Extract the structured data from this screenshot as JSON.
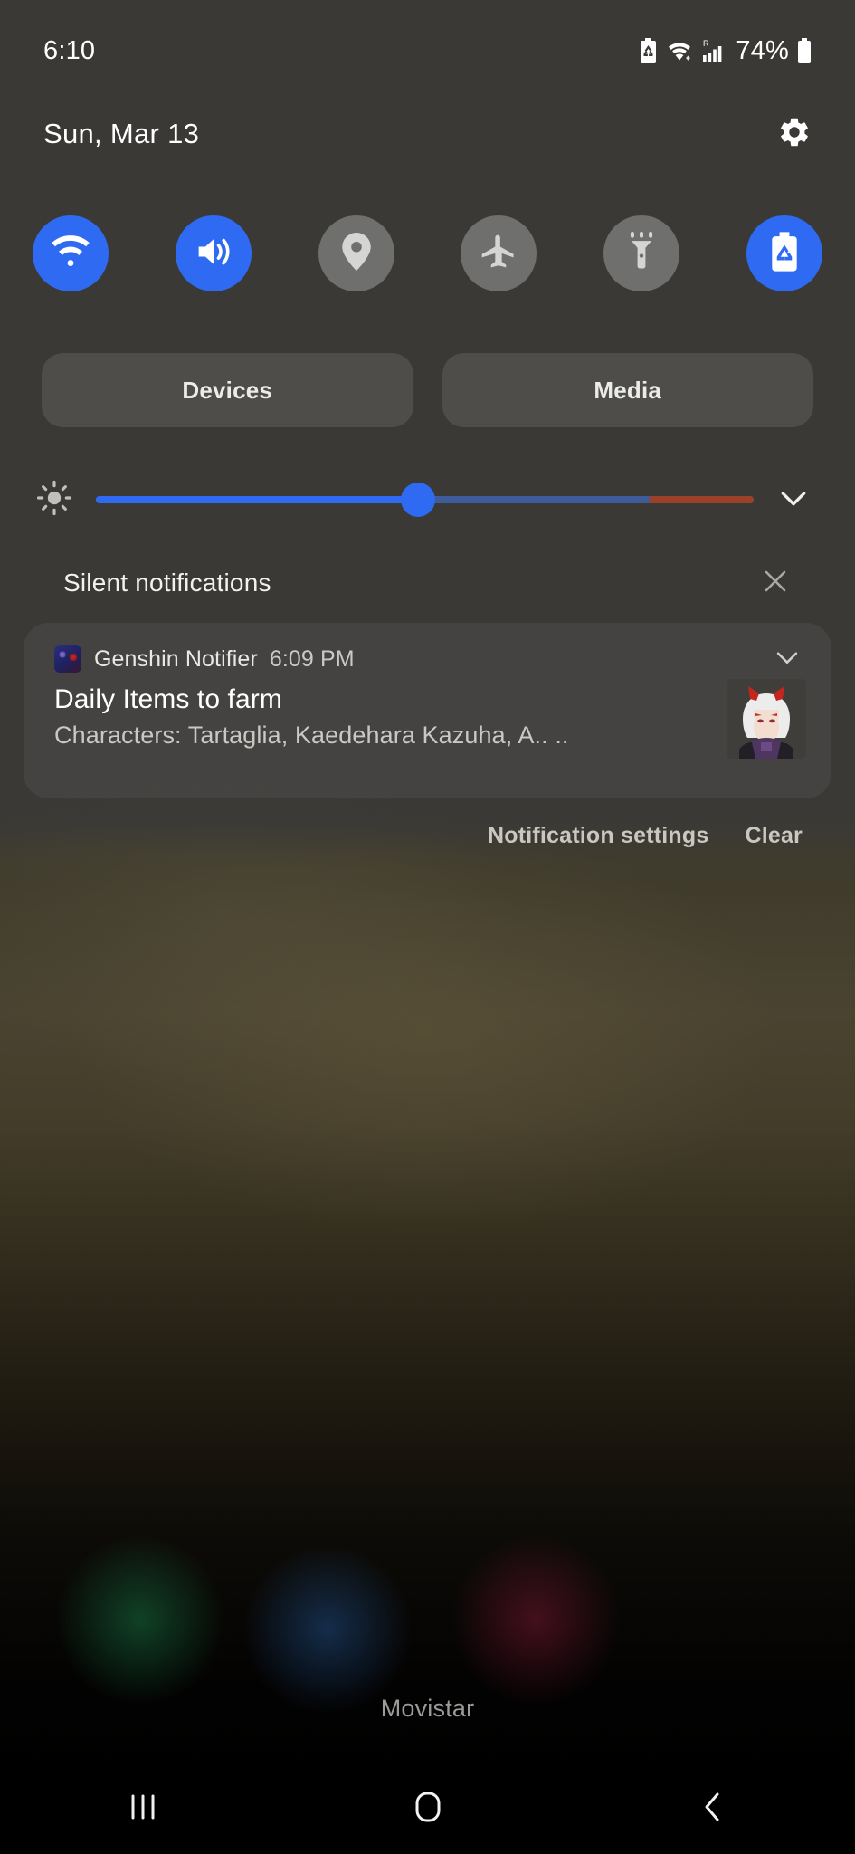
{
  "status_bar": {
    "time": "6:10",
    "battery_percent": "74%",
    "icons": [
      "battery-saver-icon",
      "wifi-icon",
      "roaming-signal-icon",
      "battery-icon"
    ]
  },
  "header": {
    "date": "Sun, Mar 13",
    "settings_icon": "gear-icon"
  },
  "quick_settings": {
    "tiles": [
      {
        "name": "wifi",
        "icon": "wifi-icon",
        "active": true
      },
      {
        "name": "sound",
        "icon": "volume-icon",
        "active": true
      },
      {
        "name": "location",
        "icon": "location-pin-icon",
        "active": false
      },
      {
        "name": "airplane-mode",
        "icon": "airplane-icon",
        "active": false
      },
      {
        "name": "flashlight",
        "icon": "flashlight-icon",
        "active": false
      },
      {
        "name": "power-saving",
        "icon": "battery-recycle-icon",
        "active": true
      }
    ],
    "devices_label": "Devices",
    "media_label": "Media"
  },
  "brightness": {
    "icon": "brightness-sun-icon",
    "value_percent": 49,
    "expand_icon": "chevron-down-icon"
  },
  "notifications": {
    "section_title": "Silent notifications",
    "dismiss_icon": "close-icon",
    "items": [
      {
        "app_name": "Genshin Notifier",
        "time": "6:09 PM",
        "title": "Daily Items to farm",
        "text": "Characters: Tartaglia, Kaedehara Kazuha, A.. ..",
        "app_icon": "genshin-notifier-app-icon",
        "thumbnail": "character-portrait-thumbnail",
        "expand_icon": "chevron-down-icon"
      }
    ],
    "settings_label": "Notification settings",
    "clear_label": "Clear"
  },
  "home": {
    "carrier": "Movistar"
  },
  "nav_bar": {
    "recents_icon": "recents-icon",
    "home_icon": "home-icon",
    "back_icon": "back-icon"
  },
  "colors": {
    "accent": "#2f6bf2",
    "tile_inactive": "#6f6f6d",
    "panel": "#3a3936",
    "warm_track": "#9c402a"
  }
}
